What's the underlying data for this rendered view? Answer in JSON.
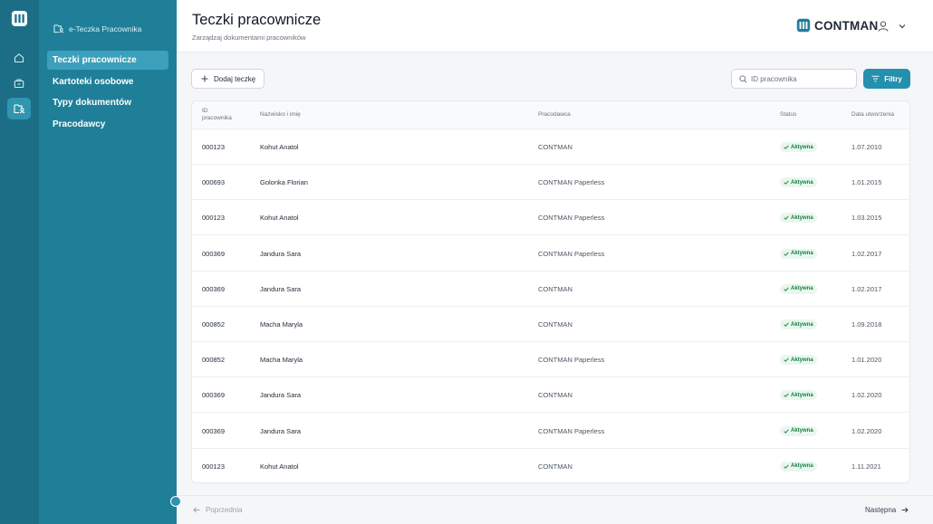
{
  "app": {
    "section": "e-Teczka Pracownika",
    "brand": "CONTMAN",
    "accent": "#1f7f99",
    "rail_color": "#1c6e86"
  },
  "rail": {
    "icons": [
      "logo-icon",
      "home-icon",
      "briefcase-icon",
      "folder-user-icon"
    ]
  },
  "sidebar": {
    "items": [
      {
        "label": "Teczki pracownicze",
        "active": true
      },
      {
        "label": "Kartoteki osobowe",
        "active": false
      },
      {
        "label": "Typy dokumentów",
        "active": false
      },
      {
        "label": "Pracodawcy",
        "active": false
      }
    ]
  },
  "header": {
    "title": "Teczki pracownicze",
    "subtitle": "Zarządzaj dokumentami pracowników"
  },
  "toolbar": {
    "add_label": "Dodaj teczkę",
    "search_placeholder": "ID pracownika",
    "search_value": "",
    "filter_label": "Filtry"
  },
  "table": {
    "columns": [
      "ID pracownika",
      "Nazwisko i imię",
      "Pracodawca",
      "Status",
      "Data utworzenia"
    ],
    "rows": [
      {
        "id": "000123",
        "name": "Kohut Anatol",
        "employer": "CONTMAN",
        "status": "Aktywna",
        "date": "1.07.2010"
      },
      {
        "id": "000693",
        "name": "Golonka Florian",
        "employer": "CONTMAN Paperless",
        "status": "Aktywna",
        "date": "1.01.2015"
      },
      {
        "id": "000123",
        "name": "Kohut Anatol",
        "employer": "CONTMAN Paperless",
        "status": "Aktywna",
        "date": "1.03.2015"
      },
      {
        "id": "000369",
        "name": "Jandura Sara",
        "employer": "CONTMAN Paperless",
        "status": "Aktywna",
        "date": "1.02.2017"
      },
      {
        "id": "000369",
        "name": "Jandura Sara",
        "employer": "CONTMAN",
        "status": "Aktywna",
        "date": "1.02.2017"
      },
      {
        "id": "000852",
        "name": "Macha Maryla",
        "employer": "CONTMAN",
        "status": "Aktywna",
        "date": "1.09.2018"
      },
      {
        "id": "000852",
        "name": "Macha Maryla",
        "employer": "CONTMAN Paperless",
        "status": "Aktywna",
        "date": "1.01.2020"
      },
      {
        "id": "000369",
        "name": "Jandura Sara",
        "employer": "CONTMAN",
        "status": "Aktywna",
        "date": "1.02.2020"
      },
      {
        "id": "000369",
        "name": "Jandura Sara",
        "employer": "CONTMAN Paperless",
        "status": "Aktywna",
        "date": "1.02.2020"
      },
      {
        "id": "000123",
        "name": "Kohut Anatol",
        "employer": "CONTMAN",
        "status": "Aktywna",
        "date": "1.11.2021"
      }
    ]
  },
  "pagination": {
    "prev_label": "Poprzednia",
    "next_label": "Następna"
  }
}
